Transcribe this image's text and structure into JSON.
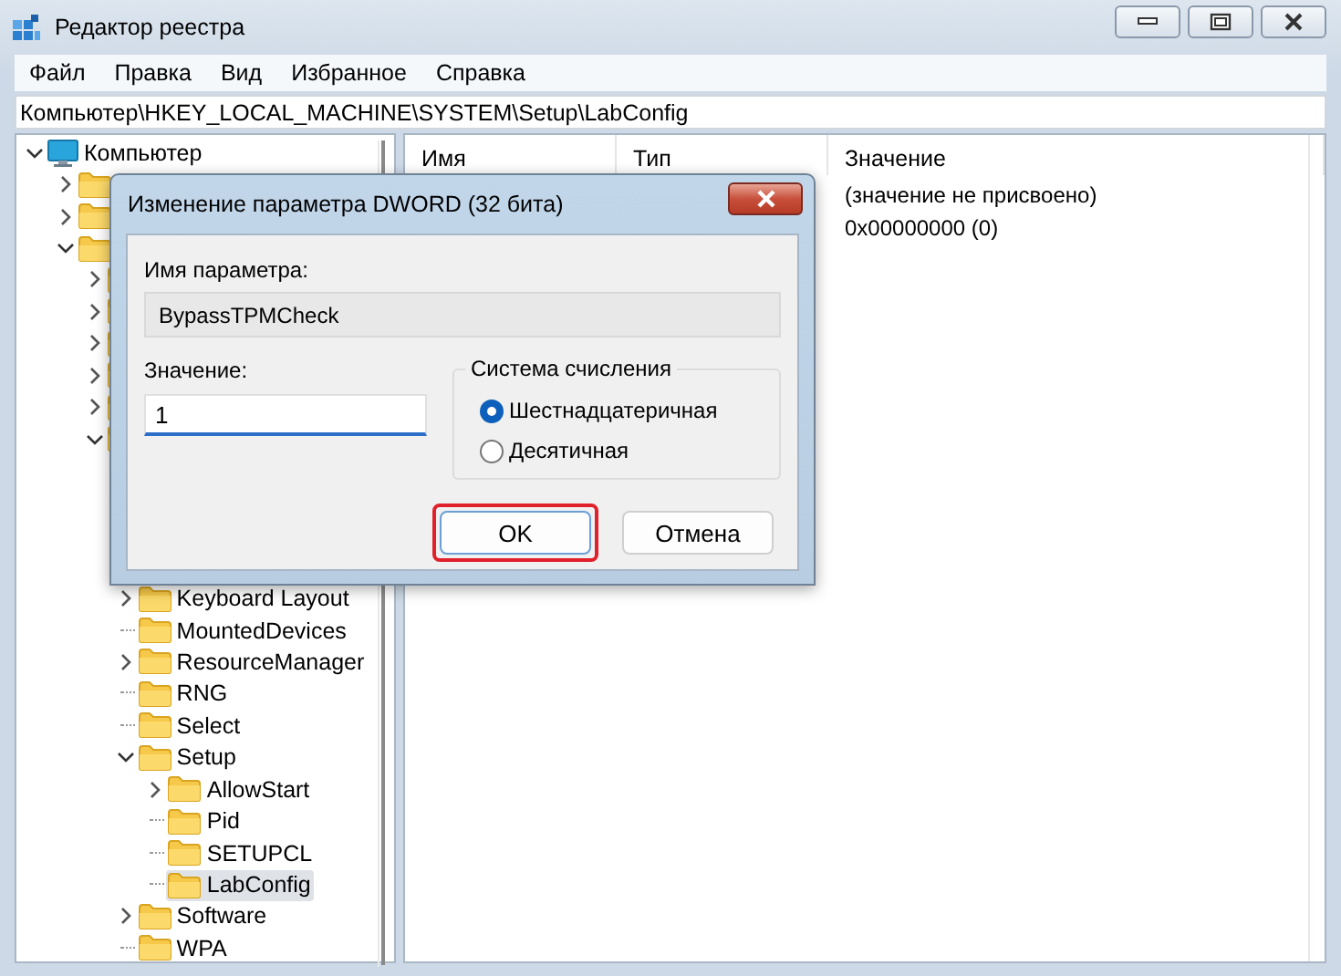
{
  "window": {
    "title": "Редактор реестра"
  },
  "menu": [
    "Файл",
    "Правка",
    "Вид",
    "Избранное",
    "Справка"
  ],
  "address": "Компьютер\\HKEY_LOCAL_MACHINE\\SYSTEM\\Setup\\LabConfig",
  "tree": {
    "label": "Компьютер",
    "expanded": true,
    "selected": false,
    "children": [
      {
        "expanded": false
      },
      {
        "expanded": false
      },
      {
        "expanded": true,
        "children": [
          {
            "expanded": false
          },
          {
            "expanded": false
          },
          {
            "expanded": false
          },
          {
            "expanded": false
          },
          {
            "expanded": false
          },
          {
            "expanded": true,
            "children": [
              {
                "label": "Keyboard Layout",
                "expanded": false,
                "selected": false
              },
              {
                "label": "MountedDevices",
                "selected": false
              },
              {
                "label": "ResourceManager",
                "expanded": false,
                "selected": false
              },
              {
                "label": "RNG",
                "selected": false
              },
              {
                "label": "Select",
                "selected": false
              },
              {
                "label": "Setup",
                "expanded": true,
                "selected": false,
                "children": [
                  {
                    "label": "AllowStart",
                    "expanded": false,
                    "selected": false
                  },
                  {
                    "label": "Pid",
                    "selected": false
                  },
                  {
                    "label": "SETUPCL",
                    "selected": false
                  },
                  {
                    "label": "LabConfig",
                    "selected": true
                  }
                ]
              },
              {
                "label": "Software",
                "expanded": false,
                "selected": false
              },
              {
                "label": "WPA",
                "selected": false
              }
            ]
          }
        ]
      }
    ]
  },
  "list": {
    "columns": [
      "Имя",
      "Тип",
      "Значение"
    ],
    "rows": [
      {
        "value": "(значение не присвоено)"
      },
      {
        "value": "0x00000000 (0)"
      }
    ]
  },
  "dialog": {
    "title": "Изменение параметра DWORD (32 бита)",
    "name_label": "Имя параметра:",
    "name_value": "BypassTPMCheck",
    "value_label": "Значение:",
    "value": "1",
    "base_group": {
      "title": "Система счисления",
      "options": [
        {
          "label": "Шестнадцатеричная",
          "selected": true
        },
        {
          "label": "Десятичная",
          "selected": false
        }
      ]
    },
    "buttons": [
      {
        "label": "OK",
        "highlighted": true
      },
      {
        "label": "Отмена",
        "highlighted": false
      }
    ]
  }
}
